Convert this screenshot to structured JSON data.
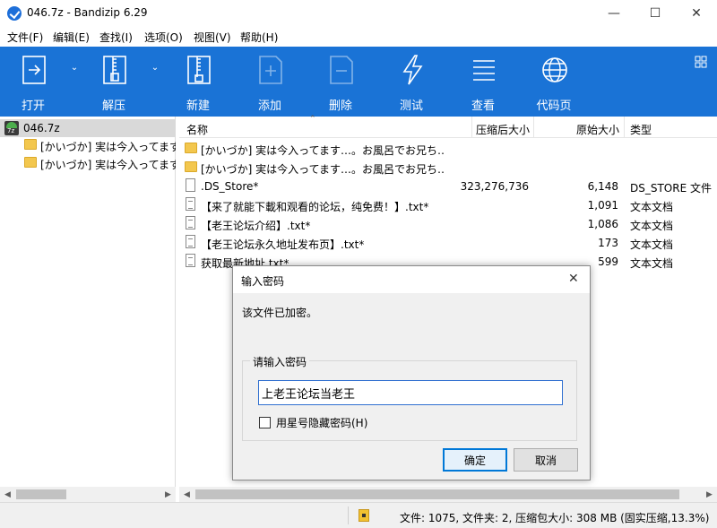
{
  "window": {
    "title": "046.7z - Bandizip 6.29"
  },
  "menu": [
    "文件(F)",
    "编辑(E)",
    "查找(I)",
    "选项(O)",
    "视图(V)",
    "帮助(H)"
  ],
  "toolbar": {
    "buttons": [
      {
        "label": "打开",
        "icon": "open-icon"
      },
      {
        "label": "解压",
        "icon": "extract-icon"
      },
      {
        "label": "新建",
        "icon": "new-archive-icon"
      },
      {
        "label": "添加",
        "icon": "add-icon"
      },
      {
        "label": "删除",
        "icon": "delete-icon"
      },
      {
        "label": "测试",
        "icon": "test-icon"
      },
      {
        "label": "查看",
        "icon": "view-icon"
      },
      {
        "label": "代码页",
        "icon": "codepage-icon"
      }
    ],
    "colors": {
      "background": "#1a73d6",
      "text": "#ffffff"
    }
  },
  "tree": {
    "root": "046.7z",
    "children": [
      "[かいづか] 実は今入ってます",
      "[かいづか] 実は今入ってます"
    ]
  },
  "filelist": {
    "columns": [
      "名称",
      "压缩后大小",
      "原始大小",
      "类型"
    ],
    "rows": [
      {
        "name": "[かいづか] 実は今入ってます…。お風呂でお兄ち…",
        "packed": "",
        "size": "",
        "type": "",
        "kind": "folder"
      },
      {
        "name": "[かいづか] 実は今入ってます…。お風呂でお兄ち…",
        "packed": "",
        "size": "",
        "type": "",
        "kind": "folder"
      },
      {
        "name": ".DS_Store*",
        "packed": "323,276,736",
        "size": "6,148",
        "type": "DS_STORE 文件",
        "kind": "file"
      },
      {
        "name": "【来了就能下載和观看的论坛，纯免费！】.txt*",
        "packed": "",
        "size": "1,091",
        "type": "文本文档",
        "kind": "doc"
      },
      {
        "name": "【老王论坛介绍】.txt*",
        "packed": "",
        "size": "1,086",
        "type": "文本文档",
        "kind": "doc"
      },
      {
        "name": "【老王论坛永久地址发布页】.txt*",
        "packed": "",
        "size": "173",
        "type": "文本文档",
        "kind": "doc"
      },
      {
        "name": "获取最新地址.txt*",
        "packed": "",
        "size": "599",
        "type": "文本文档",
        "kind": "doc"
      }
    ]
  },
  "statusbar": {
    "text": "文件: 1075, 文件夹: 2, 压缩包大小: 308 MB (固实压缩,13.3%)"
  },
  "dialog": {
    "title": "输入密码",
    "message": "该文件已加密。",
    "group_label": "请输入密码",
    "password_value": "上老王论坛当老王",
    "mask_label": "用星号隐藏密码(H)",
    "ok_label": "确定",
    "cancel_label": "取消"
  }
}
